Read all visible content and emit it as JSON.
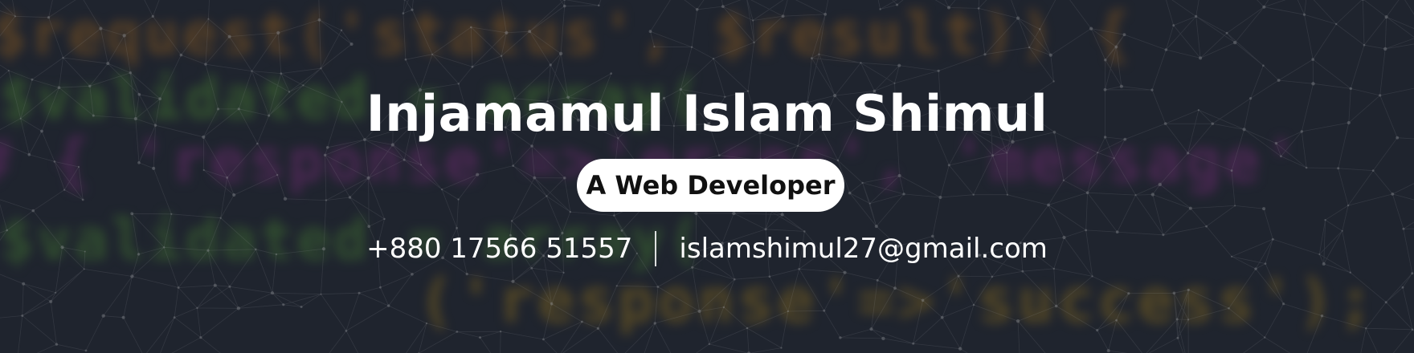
{
  "hero": {
    "name": "Injamamul Islam Shimul",
    "role": "A Web Developer",
    "phone": "+880 17566 51557",
    "email": "islamshimul27@gmail.com"
  },
  "background": {
    "code_lines": [
      {
        "text": "$request('status', $result)) {",
        "color": "#e0891d"
      },
      {
        "text": "$validated = array(",
        "color": "#69c23a"
      },
      {
        "text": "#  { 'response'=>'error', 'message'",
        "color": "#c13ab8"
      },
      {
        "text": "$validated = array(",
        "color": "#69c23a"
      },
      {
        "text": "('response'=>'success');",
        "color": "#d8a21a"
      }
    ]
  },
  "colors": {
    "background": "#262b36",
    "text": "#ffffff",
    "pill_background": "#ffffff",
    "pill_text": "#111111"
  }
}
